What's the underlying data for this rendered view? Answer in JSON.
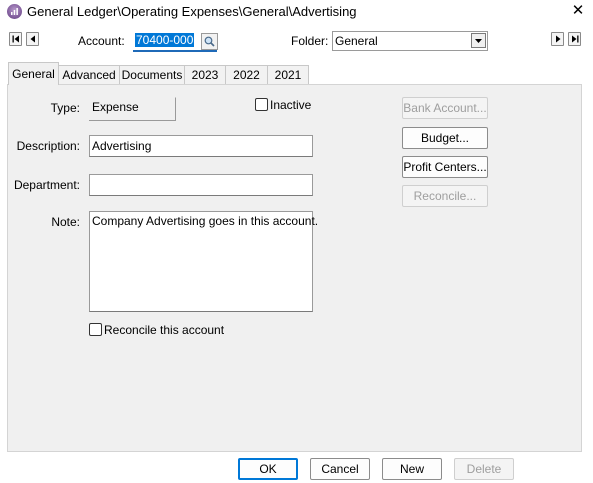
{
  "window": {
    "title": "General Ledger\\Operating Expenses\\General\\Advertising",
    "close_glyph": "✕"
  },
  "toolbar": {
    "account_label": "Account:",
    "account_value": "70400-000",
    "folder_label": "Folder:",
    "folder_value": "General"
  },
  "tabs": [
    {
      "label": "General",
      "active": true
    },
    {
      "label": "Advanced"
    },
    {
      "label": "Documents"
    },
    {
      "label": "2023"
    },
    {
      "label": "2022"
    },
    {
      "label": "2021"
    }
  ],
  "form": {
    "type_label": "Type:",
    "type_value": "Expense",
    "inactive_label": "Inactive",
    "description_label": "Description:",
    "description_value": "Advertising",
    "department_label": "Department:",
    "department_value": "",
    "note_label": "Note:",
    "note_value": "Company Advertising goes in this account.",
    "reconcile_label": "Reconcile this account"
  },
  "side_buttons": {
    "bank_account": "Bank Account...",
    "budget": "Budget...",
    "profit_centers": "Profit Centers...",
    "reconcile": "Reconcile..."
  },
  "bottom_buttons": {
    "ok": "OK",
    "cancel": "Cancel",
    "new": "New",
    "delete": "Delete"
  },
  "colors": {
    "accent": "#0078d7",
    "panel_bg": "#f0f0f0",
    "disabled_text": "#9e9e9e"
  }
}
